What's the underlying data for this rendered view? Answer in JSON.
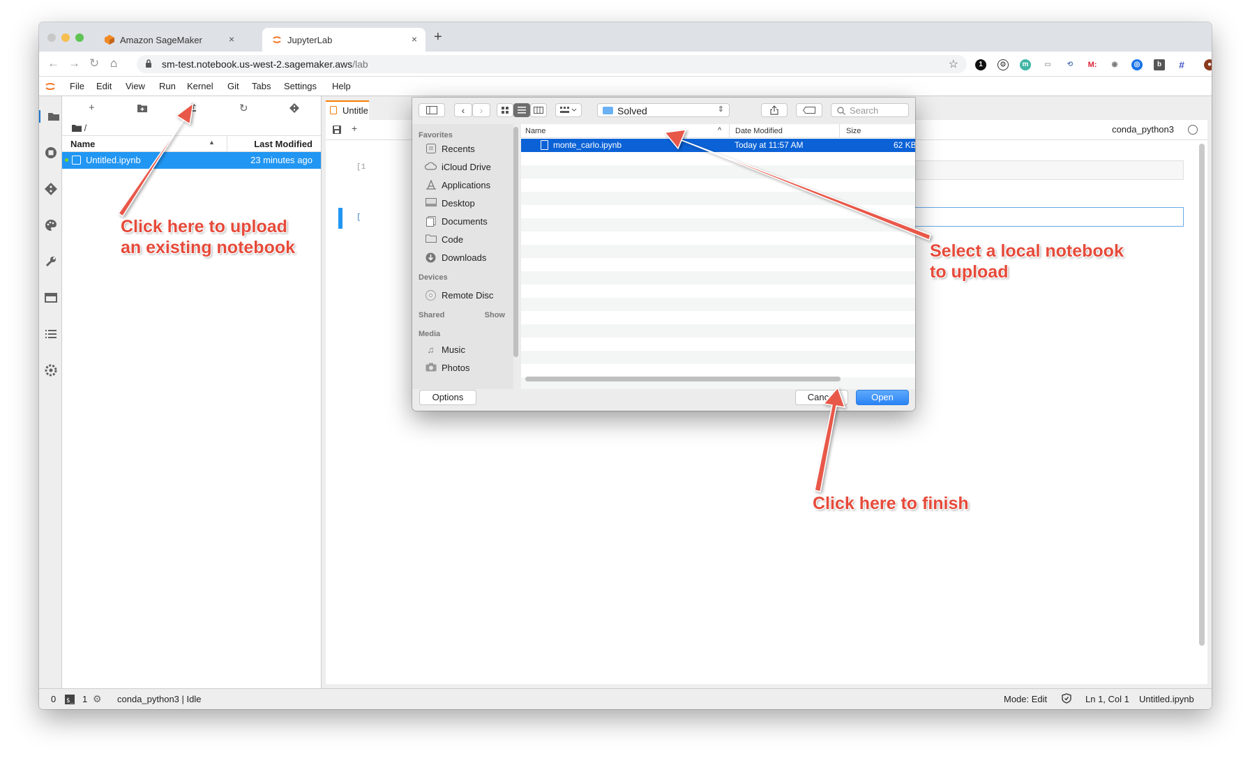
{
  "browser": {
    "tabs": [
      {
        "label": "Amazon SageMaker",
        "close": "×"
      },
      {
        "label": "JupyterLab",
        "close": "×"
      }
    ],
    "new_tab": "+",
    "url_main": "sm-test.notebook.us-west-2.sagemaker.aws",
    "url_path": "/lab",
    "nav": {
      "back": "←",
      "forward": "→",
      "reload": "↻",
      "home": "⌂"
    },
    "extensions": [
      "1",
      "⊙",
      "m",
      "▭",
      "⟲",
      "M:",
      "◉",
      "◎",
      "b",
      "#",
      "●",
      "⋮"
    ],
    "bookmark": "☆"
  },
  "menu": {
    "items": [
      "File",
      "Edit",
      "View",
      "Run",
      "Kernel",
      "Git",
      "Tabs",
      "Settings",
      "Help"
    ]
  },
  "filebrowser": {
    "breadcrumb": "/",
    "col_name": "Name",
    "col_modified": "Last Modified",
    "sort_indicator": "▲",
    "files": [
      {
        "name": "Untitled.ipynb",
        "modified": "23 minutes ago"
      }
    ]
  },
  "notebook": {
    "tab_label": "Untitle",
    "kernel": "conda_python3",
    "prompt1": "[1",
    "prompt2": "["
  },
  "dialog": {
    "folder": "Solved",
    "search_placeholder": "Search",
    "favorites_header": "Favorites",
    "favorites": [
      "Recents",
      "iCloud Drive",
      "Applications",
      "Desktop",
      "Documents",
      "Code",
      "Downloads"
    ],
    "devices_header": "Devices",
    "devices": [
      "Remote Disc"
    ],
    "shared_header": "Shared",
    "shared_show": "Show",
    "media_header": "Media",
    "media": [
      "Music",
      "Photos"
    ],
    "col_name": "Name",
    "col_date": "Date Modified",
    "col_size": "Size",
    "sort_indicator": "^",
    "files": [
      {
        "name": "monte_carlo.ipynb",
        "date": "Today at 11:57 AM",
        "size": "62 KB"
      }
    ],
    "options_label": "Options",
    "cancel_label": "Cancel",
    "open_label": "Open"
  },
  "statusbar": {
    "terminals": "0",
    "kernels": "1",
    "kernel_status": "conda_python3 | Idle",
    "mode": "Mode: Edit",
    "position": "Ln 1, Col 1",
    "filename": "Untitled.ipynb"
  },
  "annotations": {
    "upload_line1": "Click here to upload",
    "upload_line2": "an existing notebook",
    "select_line1": "Select a local notebook",
    "select_line2": "to upload",
    "finish": "Click here to finish"
  },
  "colors": {
    "annotation": "#e64a3a",
    "selection": "#2196f3",
    "dialog_selection": "#0b62d6",
    "accent": "#f57c00"
  }
}
